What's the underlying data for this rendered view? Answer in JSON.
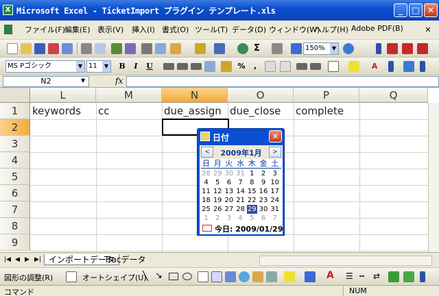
{
  "window": {
    "title": "Microsoft Excel - TicketImport プラグイン テンプレート.xls",
    "app_icon": "X"
  },
  "menu": {
    "items": [
      "ファイル(F)",
      "編集(E)",
      "表示(V)",
      "挿入(I)",
      "書式(O)",
      "ツール(T)",
      "データ(D)",
      "ウィンドウ(W)",
      "ヘルプ(H)",
      "Adobe PDF(B)"
    ]
  },
  "toolbar": {
    "zoom": "150%"
  },
  "format_bar": {
    "font": "MS Pゴシック",
    "size": "11",
    "percent": "%",
    "comma": ","
  },
  "formula_bar": {
    "name_box": "N2",
    "fx": "fx"
  },
  "grid": {
    "columns": [
      "L",
      "M",
      "N",
      "O",
      "P",
      "Q"
    ],
    "selected_column": "N",
    "rows": [
      "1",
      "2",
      "3",
      "4",
      "5",
      "6",
      "7",
      "8",
      "9"
    ],
    "selected_row": "2",
    "row1": [
      "keywords",
      "cc",
      "due_assign",
      "due_close",
      "complete",
      ""
    ]
  },
  "sheets": {
    "tab1": "インポートデータ",
    "tab2": "Tracデータ"
  },
  "drawing": {
    "draw": "図形の調整(R)",
    "autoshape": "オートシェイプ(U)"
  },
  "status": {
    "mode": "コマンド",
    "num": "NUM"
  },
  "datepicker": {
    "title": "日付",
    "month": "2009年1月",
    "prev": "<",
    "next": ">",
    "weekdays": [
      "日",
      "月",
      "火",
      "水",
      "木",
      "金",
      "土"
    ],
    "weeks": [
      [
        "28",
        "29",
        "30",
        "31",
        "1",
        "2",
        "3"
      ],
      [
        "4",
        "5",
        "6",
        "7",
        "8",
        "9",
        "10"
      ],
      [
        "11",
        "12",
        "13",
        "14",
        "15",
        "16",
        "17"
      ],
      [
        "18",
        "19",
        "20",
        "21",
        "22",
        "23",
        "24"
      ],
      [
        "25",
        "26",
        "27",
        "28",
        "29",
        "30",
        "31"
      ],
      [
        "1",
        "2",
        "3",
        "4",
        "5",
        "6",
        "7"
      ]
    ],
    "other_month_first_row_count": 4,
    "selected_day": "29",
    "today_label": "今日: 2009/01/29"
  },
  "colors": {
    "title_blue": "#0a4fd0",
    "selected_header": "#f7a93a",
    "selected_day": "#2f4fa8"
  }
}
